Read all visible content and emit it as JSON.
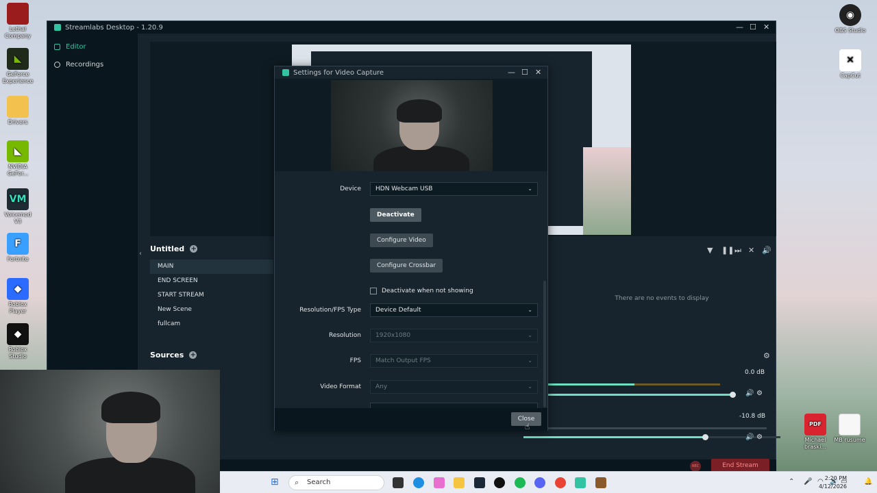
{
  "desktop": {
    "left_icons": [
      {
        "label": "Lethal Company",
        "color": "#9b1c1c"
      },
      {
        "label": "GeForce Experience",
        "color": "#76b900"
      },
      {
        "label": "Drivers",
        "color": "#f2c14e"
      },
      {
        "label": "NVIDIA GeFor...",
        "color": "#76b900"
      },
      {
        "label": "Voicemod V3",
        "color": "#1f2b33"
      },
      {
        "label": "Fortnite",
        "color": "#3aa0ff"
      },
      {
        "label": "Roblox Player",
        "color": "#2b6cff"
      },
      {
        "label": "Roblox Studio",
        "color": "#111111"
      }
    ],
    "right_icons": [
      {
        "label": "OBS Studio",
        "color": "#222222"
      },
      {
        "label": "CapCut",
        "color": "#ffffff"
      }
    ],
    "files": [
      {
        "label": "Michael braski...",
        "icon": "PDF"
      },
      {
        "label": "MB rusume",
        "icon": ""
      }
    ]
  },
  "app": {
    "title": "Streamlabs Desktop - 1.20.9",
    "nav": [
      {
        "label": "Editor",
        "active": true
      },
      {
        "label": "Recordings",
        "active": false
      }
    ],
    "scenes_title": "Untitled",
    "scenes": [
      "MAIN",
      "END SCREEN",
      "START STREAM",
      "New Scene",
      "fullcam"
    ],
    "sources_title": "Sources",
    "events_empty": "There are no events to display",
    "mixer": {
      "db1": "0.0 dB",
      "db2": "-10.8 dB",
      "level1": 0.95,
      "level2": 0.72
    },
    "rec_label": "REC",
    "end_stream": "End Stream"
  },
  "dialog": {
    "title": "Settings for Video Capture",
    "device_label": "Device",
    "device_value": "HDN Webcam USB",
    "deactivate": "Deactivate",
    "configure_video": "Configure Video",
    "configure_crossbar": "Configure Crossbar",
    "deactivate_when_not_showing": "Deactivate when not showing",
    "resfps_label": "Resolution/FPS Type",
    "resfps_value": "Device Default",
    "resolution_label": "Resolution",
    "resolution_value": "1920x1080",
    "fps_label": "FPS",
    "fps_value": "Match Output FPS",
    "video_format_label": "Video Format",
    "video_format_value": "Any",
    "close": "Close"
  },
  "taskbar": {
    "search_placeholder": "Search",
    "time": "2:20 PM",
    "date": "4/12/2026"
  }
}
